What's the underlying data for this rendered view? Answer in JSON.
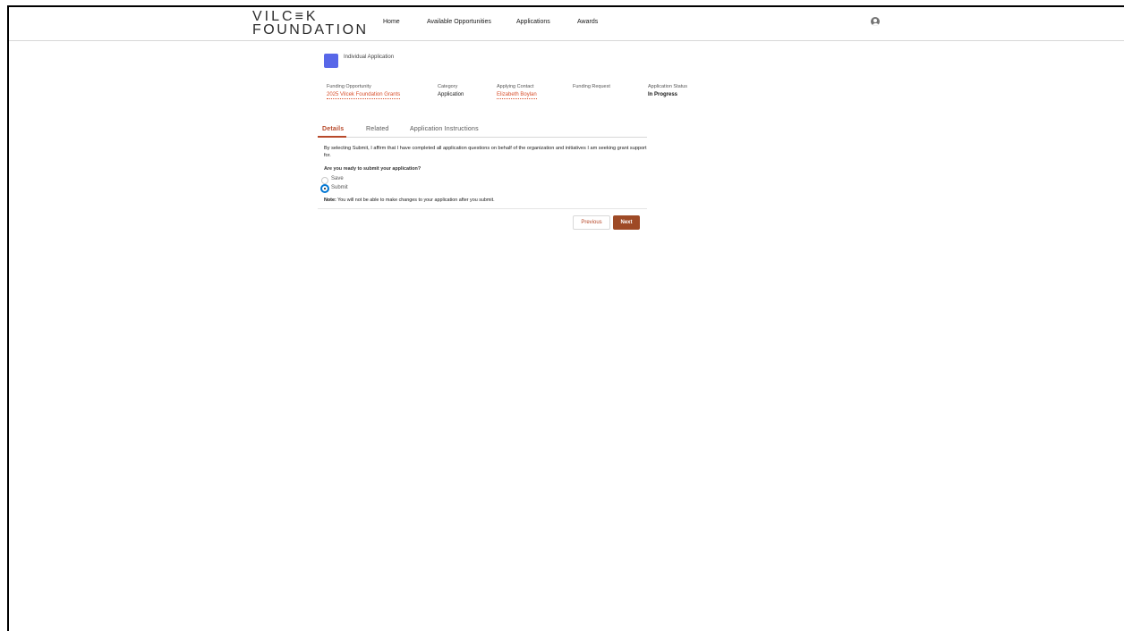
{
  "header": {
    "logo_line1": "VILC≡K",
    "logo_line2": "FOUNDATION",
    "nav": [
      {
        "label": "Home"
      },
      {
        "label": "Available Opportunities"
      },
      {
        "label": "Applications"
      },
      {
        "label": "Awards"
      }
    ],
    "avatar_icon": "user-avatar-icon"
  },
  "record": {
    "icon_color": "#5867e8",
    "title": "Individual Application",
    "fields": [
      {
        "label": "Funding Opportunity",
        "value": "2025 Vilcek Foundation Grants"
      },
      {
        "label": "Category",
        "value": "Application"
      },
      {
        "label": "Applying Contact",
        "value": "Elizabeth Boylan"
      },
      {
        "label": "Funding Request",
        "value": ""
      },
      {
        "label": "Application Status",
        "value": "In Progress"
      }
    ]
  },
  "tabs": [
    {
      "label": "Details",
      "active": true
    },
    {
      "label": "Related"
    },
    {
      "label": "Application Instructions"
    }
  ],
  "details": {
    "affirm_text": "By selecting Submit, I affirm that I have completed all application questions on behalf of the organization and initiatives I am seeking grant support for.",
    "question": "Are you ready to submit your application?",
    "options": [
      {
        "label": "Save",
        "selected": false
      },
      {
        "label": "Submit",
        "selected": true
      }
    ],
    "note_label": "Note:",
    "note_text": " You will not be able to make changes to your application after you submit."
  },
  "buttons": {
    "previous": "Previous",
    "next": "Next"
  },
  "colors": {
    "accent": "#b7492a",
    "link": "#d8502c",
    "primary_button": "#9e4a26"
  }
}
